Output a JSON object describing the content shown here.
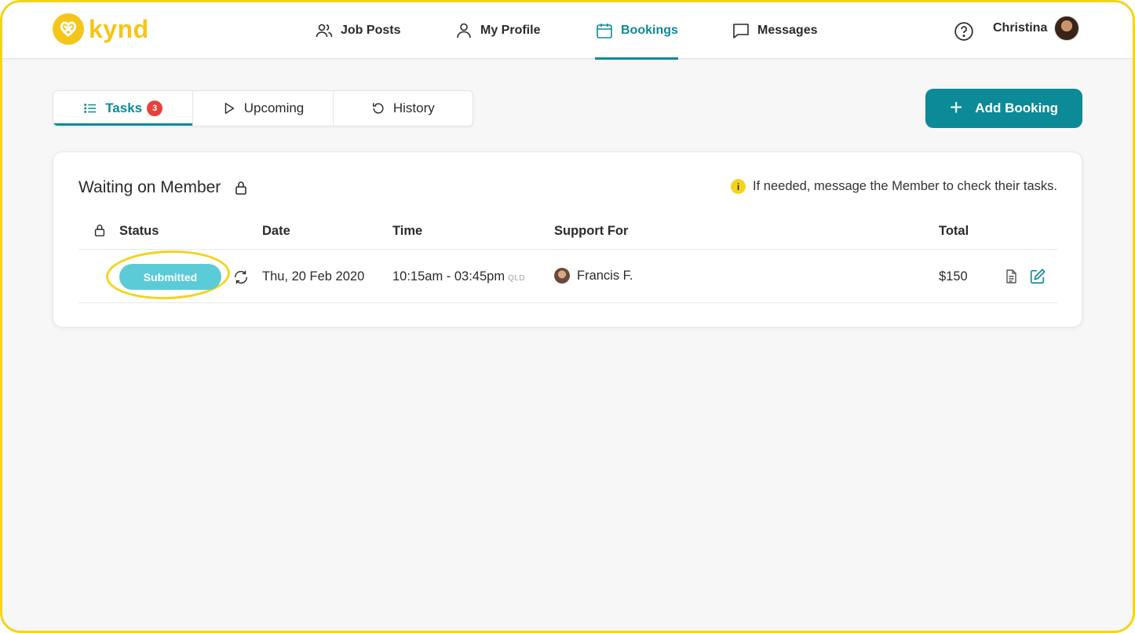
{
  "brand": {
    "name": "kynd",
    "color": "#f5c518"
  },
  "nav": {
    "items": [
      {
        "label": "Job Posts",
        "icon": "users-icon"
      },
      {
        "label": "My Profile",
        "icon": "user-icon"
      },
      {
        "label": "Bookings",
        "icon": "calendar-icon",
        "active": true
      },
      {
        "label": "Messages",
        "icon": "chat-icon"
      }
    ],
    "user_name": "Christina"
  },
  "tabs": [
    {
      "label": "Tasks",
      "badge": "3",
      "icon": "list-icon",
      "active": true
    },
    {
      "label": "Upcoming",
      "icon": "play-icon"
    },
    {
      "label": "History",
      "icon": "history-icon"
    }
  ],
  "add_booking_label": "Add Booking",
  "card": {
    "title": "Waiting on Member",
    "info_text": "If needed, message the Member to check their tasks.",
    "info_icon_glyph": "i",
    "columns": {
      "status": "Status",
      "date": "Date",
      "time": "Time",
      "support": "Support For",
      "total": "Total"
    },
    "rows": [
      {
        "status": "Submitted",
        "date": "Thu, 20 Feb 2020",
        "time": "10:15am - 03:45pm",
        "timezone": "QLD",
        "support_for": "Francis F.",
        "total": "$150"
      }
    ]
  },
  "colors": {
    "accent": "#0d8a97",
    "status_submitted": "#5bcbd7",
    "badge": "#e8413c",
    "highlight": "#f5d31b"
  }
}
